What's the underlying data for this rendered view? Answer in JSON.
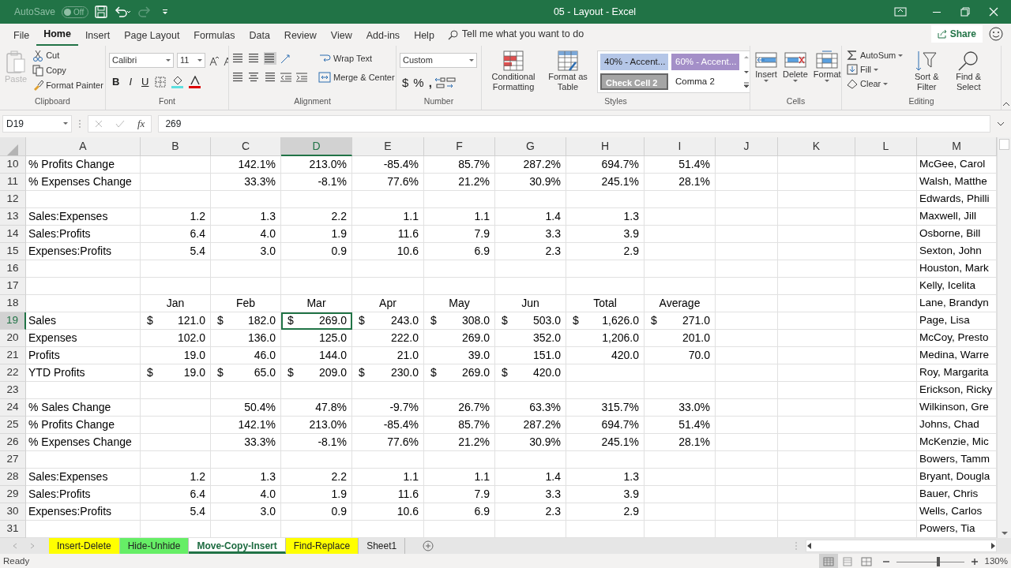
{
  "title_bar": {
    "autosave_label": "AutoSave",
    "autosave_state": "Off",
    "autosave_on": false,
    "title": "05 - Layout  -  Excel"
  },
  "menu_tabs": [
    {
      "label": "File",
      "selected": false
    },
    {
      "label": "Home",
      "selected": true
    },
    {
      "label": "Insert",
      "selected": false
    },
    {
      "label": "Page Layout",
      "selected": false
    },
    {
      "label": "Formulas",
      "selected": false
    },
    {
      "label": "Data",
      "selected": false
    },
    {
      "label": "Review",
      "selected": false
    },
    {
      "label": "View",
      "selected": false
    },
    {
      "label": "Add-ins",
      "selected": false
    },
    {
      "label": "Help",
      "selected": false
    }
  ],
  "tell_me": "Tell me what you want to do",
  "share": "Share",
  "ribbon": [
    {
      "label": "Clipboard",
      "items": [
        {
          "label": "Paste",
          "disabled": true
        },
        {
          "label": "Cut",
          "disabled": false
        },
        {
          "label": "Copy",
          "disabled": false
        },
        {
          "label": "Format Painter",
          "disabled": false
        }
      ]
    },
    {
      "label": "Font",
      "font": "Calibri",
      "size": "11",
      "buttons": [
        "B",
        "I",
        "U"
      ]
    },
    {
      "label": "Alignment",
      "items": [
        {
          "label": "Wrap Text"
        },
        {
          "label": "Merge & Center"
        }
      ]
    },
    {
      "label": "Number",
      "format": "Custom",
      "buttons": [
        "$",
        "%",
        ","
      ]
    },
    {
      "label": "Styles",
      "items": [
        {
          "label": "Conditional Formatting"
        },
        {
          "label": "Format as Table"
        }
      ],
      "styles": [
        {
          "label": "40% - Accent...",
          "color": "#b4c6e7"
        },
        {
          "label": "60% - Accent...",
          "color": "#a48fc8"
        },
        {
          "label": "Check Cell 2",
          "color": "#a5a5a5"
        },
        {
          "label": "Comma 2",
          "color": "#ffffff"
        }
      ]
    },
    {
      "label": "Cells",
      "items": [
        {
          "label": "Insert"
        },
        {
          "label": "Delete"
        },
        {
          "label": "Format"
        }
      ]
    },
    {
      "label": "Editing",
      "items": [
        {
          "label": "AutoSum"
        },
        {
          "label": "Fill"
        },
        {
          "label": "Clear"
        },
        {
          "label": "Sort & Filter"
        },
        {
          "label": "Find & Select"
        }
      ]
    }
  ],
  "formula_bar": {
    "name_box": "D19",
    "function_label": "fx",
    "value": "269"
  },
  "columns": [
    {
      "label": "A",
      "selected": false
    },
    {
      "label": "B",
      "selected": false
    },
    {
      "label": "C",
      "selected": false
    },
    {
      "label": "D",
      "selected": true
    },
    {
      "label": "E",
      "selected": false
    },
    {
      "label": "F",
      "selected": false
    },
    {
      "label": "G",
      "selected": false
    },
    {
      "label": "H",
      "selected": false
    },
    {
      "label": "I",
      "selected": false
    },
    {
      "label": "J",
      "selected": false
    },
    {
      "label": "K",
      "selected": false
    },
    {
      "label": "L",
      "selected": false
    },
    {
      "label": "M",
      "selected": false
    }
  ],
  "rows": [
    {
      "label": "10",
      "selected": false,
      "kind": "data",
      "cells": {
        "A": "% Profits Change",
        "C": "142.1%",
        "D": "213.0%",
        "E": "-85.4%",
        "F": "85.7%",
        "G": "287.2%",
        "H": "694.7%",
        "I": "51.4%",
        "M": "McGee, Carol"
      }
    },
    {
      "label": "11",
      "selected": false,
      "kind": "data",
      "cells": {
        "A": "% Expenses Change",
        "C": "33.3%",
        "D": "-8.1%",
        "E": "77.6%",
        "F": "21.2%",
        "G": "30.9%",
        "H": "245.1%",
        "I": "28.1%",
        "M": "Walsh, Matthe"
      }
    },
    {
      "label": "12",
      "selected": false,
      "kind": "data",
      "cells": {
        "M": "Edwards, Philli"
      }
    },
    {
      "label": "13",
      "selected": false,
      "kind": "data",
      "cells": {
        "A": "Sales:Expenses",
        "B": "1.2",
        "C": "1.3",
        "D": "2.2",
        "E": "1.1",
        "F": "1.1",
        "G": "1.4",
        "H": "1.3",
        "M": "Maxwell, Jill"
      }
    },
    {
      "label": "14",
      "selected": false,
      "kind": "data",
      "cells": {
        "A": "Sales:Profits",
        "B": "6.4",
        "C": "4.0",
        "D": "1.9",
        "E": "11.6",
        "F": "7.9",
        "G": "3.3",
        "H": "3.9",
        "M": "Osborne, Bill"
      }
    },
    {
      "label": "15",
      "selected": false,
      "kind": "data",
      "cells": {
        "A": "Expenses:Profits",
        "B": "5.4",
        "C": "3.0",
        "D": "0.9",
        "E": "10.6",
        "F": "6.9",
        "G": "2.3",
        "H": "2.9",
        "M": "Sexton, John"
      }
    },
    {
      "label": "16",
      "selected": false,
      "kind": "data",
      "cells": {
        "M": "Houston, Mark"
      }
    },
    {
      "label": "17",
      "selected": false,
      "kind": "data",
      "cells": {
        "M": "Kelly, Icelita"
      }
    },
    {
      "label": "18",
      "selected": false,
      "kind": "data",
      "cells": {
        "B": {
          "kind": "heading",
          "text": "Jan"
        },
        "C": {
          "kind": "heading",
          "text": "Feb"
        },
        "D": {
          "kind": "heading",
          "text": "Mar"
        },
        "E": {
          "kind": "heading",
          "text": "Apr"
        },
        "F": {
          "kind": "heading",
          "text": "May"
        },
        "G": {
          "kind": "heading",
          "text": "Jun"
        },
        "H": {
          "kind": "heading",
          "text": "Total"
        },
        "I": {
          "kind": "heading",
          "text": "Average"
        },
        "M": "Lane, Brandyn"
      }
    },
    {
      "label": "19",
      "selected": true,
      "kind": "data",
      "cells": {
        "A": "Sales",
        "B": [
          "$",
          "121.0"
        ],
        "C": [
          "$",
          "182.0"
        ],
        "D": [
          "$",
          "269.0"
        ],
        "E": [
          "$",
          "243.0"
        ],
        "F": [
          "$",
          "308.0"
        ],
        "G": [
          "$",
          "503.0"
        ],
        "H": [
          "$",
          "1,626.0"
        ],
        "I": [
          "$",
          "271.0"
        ],
        "M": "Page, Lisa"
      }
    },
    {
      "label": "20",
      "selected": false,
      "kind": "data",
      "cells": {
        "A": "Expenses",
        "B": "102.0",
        "C": "136.0",
        "D": "125.0",
        "E": "222.0",
        "F": "269.0",
        "G": "352.0",
        "H": "1,206.0",
        "I": "201.0",
        "M": "McCoy, Presto"
      }
    },
    {
      "label": "21",
      "selected": false,
      "kind": "data",
      "cells": {
        "A": "Profits",
        "B": "19.0",
        "C": "46.0",
        "D": "144.0",
        "E": "21.0",
        "F": "39.0",
        "G": "151.0",
        "H": "420.0",
        "I": "70.0",
        "M": "Medina, Warre"
      }
    },
    {
      "label": "22",
      "selected": false,
      "kind": "data",
      "cells": {
        "A": "YTD Profits",
        "B": [
          "$",
          "19.0"
        ],
        "C": [
          "$",
          "65.0"
        ],
        "D": [
          "$",
          "209.0"
        ],
        "E": [
          "$",
          "230.0"
        ],
        "F": [
          "$",
          "269.0"
        ],
        "G": [
          "$",
          "420.0"
        ],
        "M": "Roy, Margarita"
      }
    },
    {
      "label": "23",
      "selected": false,
      "kind": "data",
      "cells": {
        "M": "Erickson, Ricky"
      }
    },
    {
      "label": "24",
      "selected": false,
      "kind": "data",
      "cells": {
        "A": "% Sales Change",
        "C": "50.4%",
        "D": "47.8%",
        "E": "-9.7%",
        "F": "26.7%",
        "G": "63.3%",
        "H": "315.7%",
        "I": "33.0%",
        "M": "Wilkinson, Gre"
      }
    },
    {
      "label": "25",
      "selected": false,
      "kind": "data",
      "cells": {
        "A": "% Profits Change",
        "C": "142.1%",
        "D": "213.0%",
        "E": "-85.4%",
        "F": "85.7%",
        "G": "287.2%",
        "H": "694.7%",
        "I": "51.4%",
        "M": "Johns, Chad"
      }
    },
    {
      "label": "26",
      "selected": false,
      "kind": "data",
      "cells": {
        "A": "% Expenses Change",
        "C": "33.3%",
        "D": "-8.1%",
        "E": "77.6%",
        "F": "21.2%",
        "G": "30.9%",
        "H": "245.1%",
        "I": "28.1%",
        "M": "McKenzie, Mic"
      }
    },
    {
      "label": "27",
      "selected": false,
      "kind": "data",
      "cells": {
        "M": "Bowers, Tamm"
      }
    },
    {
      "label": "28",
      "selected": false,
      "kind": "data",
      "cells": {
        "A": "Sales:Expenses",
        "B": "1.2",
        "C": "1.3",
        "D": "2.2",
        "E": "1.1",
        "F": "1.1",
        "G": "1.4",
        "H": "1.3",
        "M": "Bryant, Dougla"
      }
    },
    {
      "label": "29",
      "selected": false,
      "kind": "data",
      "cells": {
        "A": "Sales:Profits",
        "B": "6.4",
        "C": "4.0",
        "D": "1.9",
        "E": "11.6",
        "F": "7.9",
        "G": "3.3",
        "H": "3.9",
        "M": "Bauer, Chris"
      }
    },
    {
      "label": "30",
      "selected": false,
      "kind": "data",
      "cells": {
        "A": "Expenses:Profits",
        "B": "5.4",
        "C": "3.0",
        "D": "0.9",
        "E": "10.6",
        "F": "6.9",
        "G": "2.3",
        "H": "2.9",
        "M": "Wells, Carlos"
      }
    },
    {
      "label": "31",
      "selected": false,
      "kind": "data",
      "cells": {
        "M": "Powers, Tia"
      }
    }
  ],
  "sheet_tabs": [
    {
      "label": "Insert-Delete",
      "color": "#ffff00",
      "selected": false
    },
    {
      "label": "Hide-Unhide",
      "color": "#66ee66",
      "selected": false
    },
    {
      "label": "Move-Copy-Insert",
      "selected": true
    },
    {
      "label": "Find-Replace",
      "color": "#ffff00",
      "selected": false
    },
    {
      "label": "Sheet1",
      "selected": false
    }
  ],
  "status_bar": {
    "text": "Ready",
    "views": [
      {
        "selected": true
      },
      {
        "selected": false
      },
      {
        "selected": false
      }
    ],
    "zoom": {
      "label": "130%",
      "level": 0.62
    }
  }
}
